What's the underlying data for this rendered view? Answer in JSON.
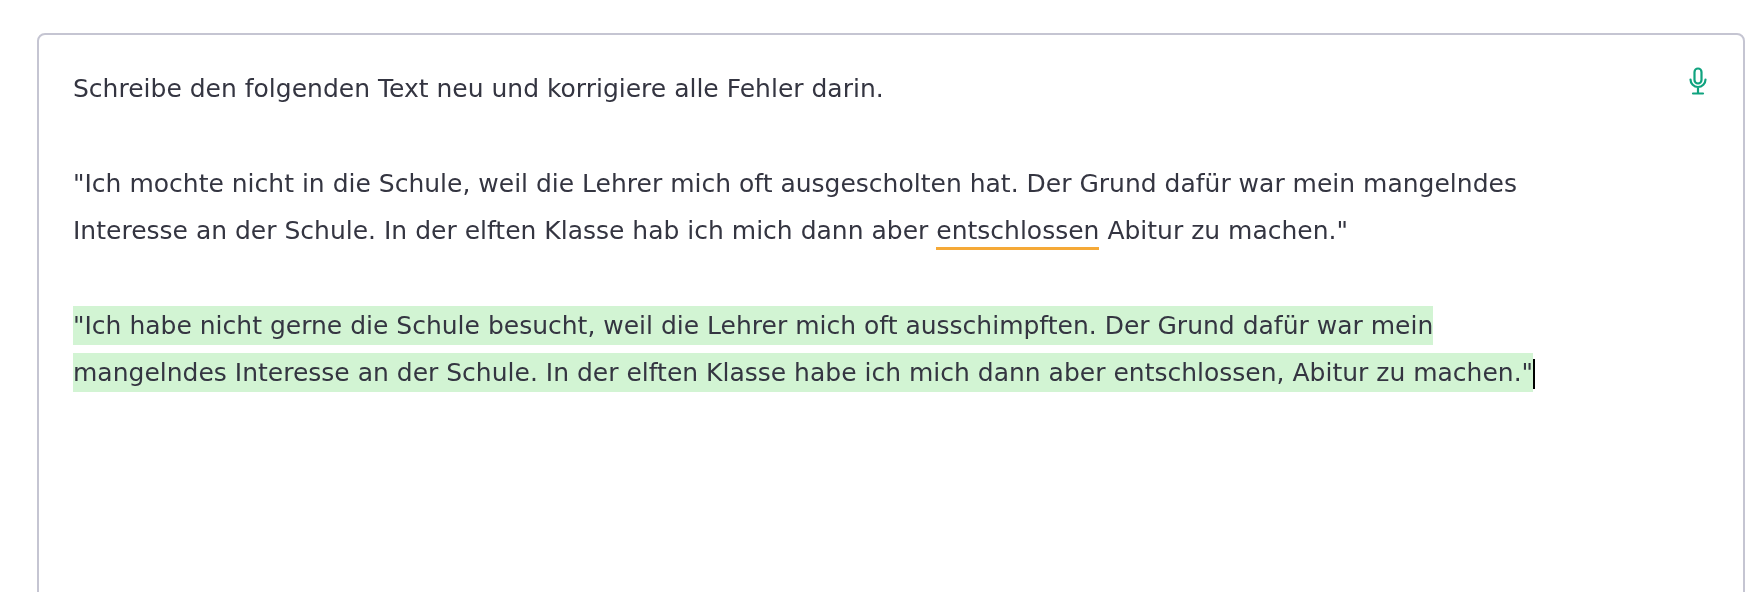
{
  "prompt_field": {
    "paragraphs": [
      {
        "selected": false,
        "cursor": false,
        "segments": [
          {
            "text": "Schreibe den folgenden Text neu und korrigiere alle Fehler darin.",
            "flagged": false
          }
        ]
      },
      {
        "selected": false,
        "cursor": false,
        "segments": [
          {
            "text": "\"Ich mochte nicht in die Schule, weil die Lehrer mich oft ausgescholten hat. Der Grund dafür war mein mangelndes Interesse an der Schule. In der elften Klasse hab ich mich dann aber ",
            "flagged": false
          },
          {
            "text": "entschlossen",
            "flagged": true
          },
          {
            "text": " Abitur zu machen.\"",
            "flagged": false
          }
        ]
      },
      {
        "selected": true,
        "cursor": true,
        "segments": [
          {
            "text": "\"Ich habe nicht gerne die Schule besucht, weil die Lehrer mich oft ausschimpften. Der Grund dafür war mein mangelndes Interesse an der Schule. In der elften Klasse habe ich mich dann aber entschlossen, Abitur zu machen.\"",
            "flagged": false
          }
        ]
      }
    ]
  }
}
